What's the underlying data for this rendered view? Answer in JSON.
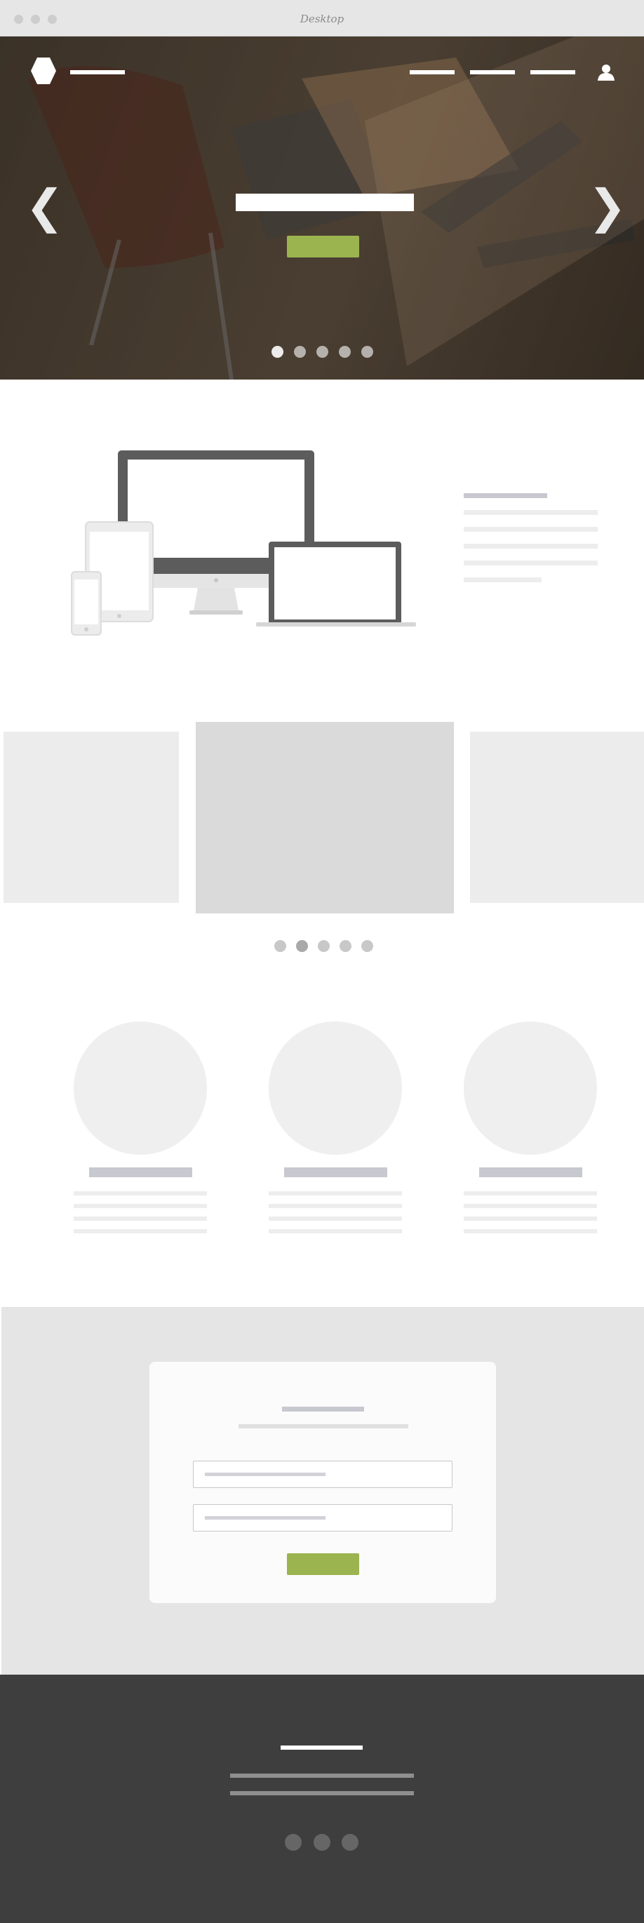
{
  "window": {
    "title": "Desktop"
  },
  "colors": {
    "accent_green": "#9cb450",
    "hero_overlay": "#3b3128",
    "section_gray": "#e5e5e5",
    "footer_dark": "#3e3e3e"
  },
  "header": {
    "logo_icon": "hexagon-logo-icon",
    "nav_items": 3,
    "user_icon": "user-icon"
  },
  "hero": {
    "prev_icon": "chevron-left-icon",
    "next_icon": "chevron-right-icon",
    "prev_glyph": "❮",
    "next_glyph": "❯",
    "slides": 5,
    "active_slide": 1
  },
  "carousel": {
    "dots": 5,
    "active_dot": 2
  },
  "features": {
    "count": 3
  },
  "signup": {
    "fields": 2
  },
  "footer": {
    "social_icons": 3
  }
}
